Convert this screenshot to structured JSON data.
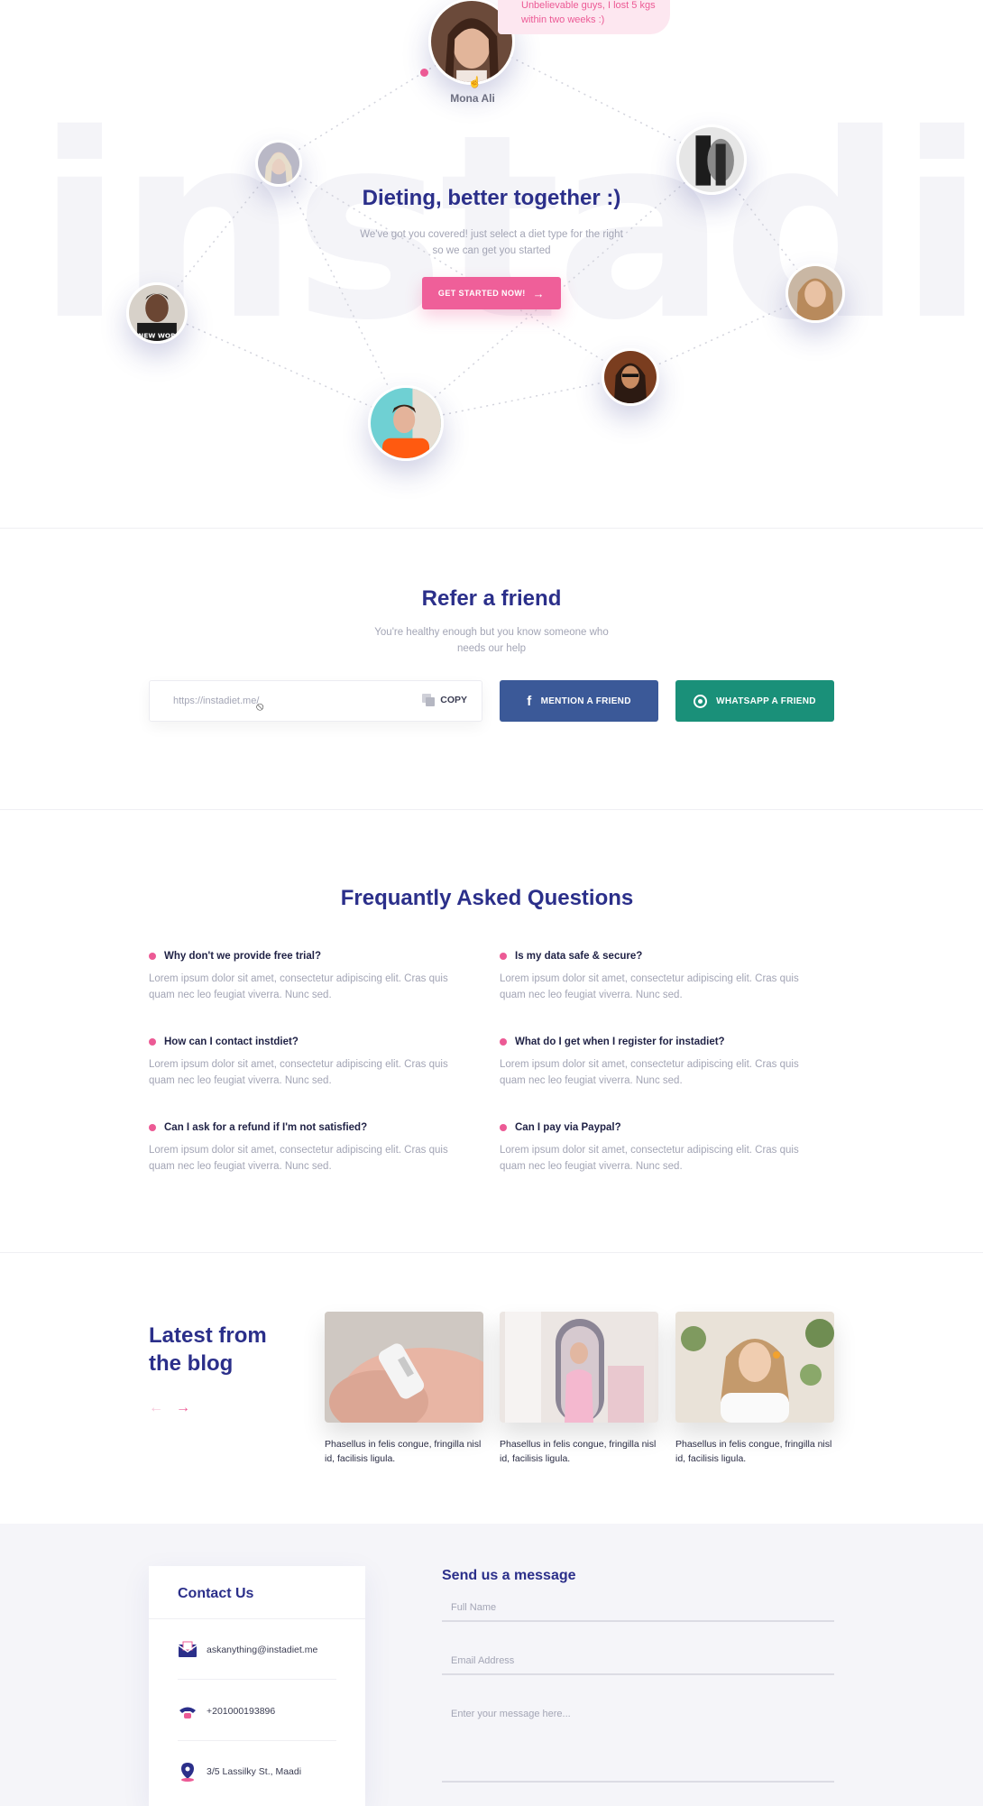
{
  "hero": {
    "watermark": "instadiet",
    "testimonial_name": "Mona Ali",
    "testimonial_quote": "Unbelievable guys, I lost 5 kgs within two weeks :)",
    "title": "Dieting, better together :)",
    "subtitle": "We've got you covered! just select a diet type for the right so we can get you started",
    "cta_label": "GET STARTED NOW!",
    "shirt_text": "NEW WOR"
  },
  "refer": {
    "title": "Refer a friend",
    "subtitle": "You're healthy enough but you know someone who needs our help",
    "link_value": "https://instadiet.me/",
    "copy_label": "COPY",
    "facebook_label": "MENTION A FRIEND",
    "whatsapp_label": "WHATSAPP A FRIEND"
  },
  "faq": {
    "title": "Frequantly Asked Questions",
    "items": [
      {
        "question": "Why don't we provide free trial?",
        "answer": "Lorem ipsum dolor sit amet, consectetur adipiscing elit. Cras quis quam nec leo feugiat viverra. Nunc sed."
      },
      {
        "question": "Is my data safe & secure?",
        "answer": "Lorem ipsum dolor sit amet, consectetur adipiscing elit. Cras quis quam nec leo feugiat viverra. Nunc sed."
      },
      {
        "question": "How can I contact instdiet?",
        "answer": "Lorem ipsum dolor sit amet, consectetur adipiscing elit. Cras quis quam nec leo feugiat viverra. Nunc sed."
      },
      {
        "question": "What do I get when I register for instadiet?",
        "answer": "Lorem ipsum dolor sit amet, consectetur adipiscing elit. Cras quis quam nec leo feugiat viverra. Nunc sed."
      },
      {
        "question": "Can I ask for a refund if I'm not satisfied?",
        "answer": "Lorem ipsum dolor sit amet, consectetur adipiscing elit. Cras quis quam nec leo feugiat viverra. Nunc sed."
      },
      {
        "question": "Can I pay via Paypal?",
        "answer": "Lorem ipsum dolor sit amet, consectetur adipiscing elit. Cras quis quam nec leo feugiat viverra. Nunc sed."
      }
    ]
  },
  "blog": {
    "title": "Latest from the blog",
    "posts": [
      {
        "excerpt": "Phasellus in felis congue, fringilla nisl id, facilisis ligula."
      },
      {
        "excerpt": "Phasellus in felis congue, fringilla nisl id, facilisis ligula."
      },
      {
        "excerpt": "Phasellus in felis congue, fringilla nisl id, facilisis ligula."
      }
    ]
  },
  "contact": {
    "card_title": "Contact Us",
    "email": "askanything@instadiet.me",
    "phone": "+201000193896",
    "address": "3/5 Lassilky St., Maadi",
    "form_title": "Send us a message",
    "name_placeholder": "Full Name",
    "email_placeholder": "Email Address",
    "message_placeholder": "Enter your message here..."
  },
  "colors": {
    "brand_navy": "#2b2f8a",
    "accent_pink": "#ef5f99",
    "facebook_blue": "#3b5998",
    "whatsapp_green": "#1a9079"
  }
}
